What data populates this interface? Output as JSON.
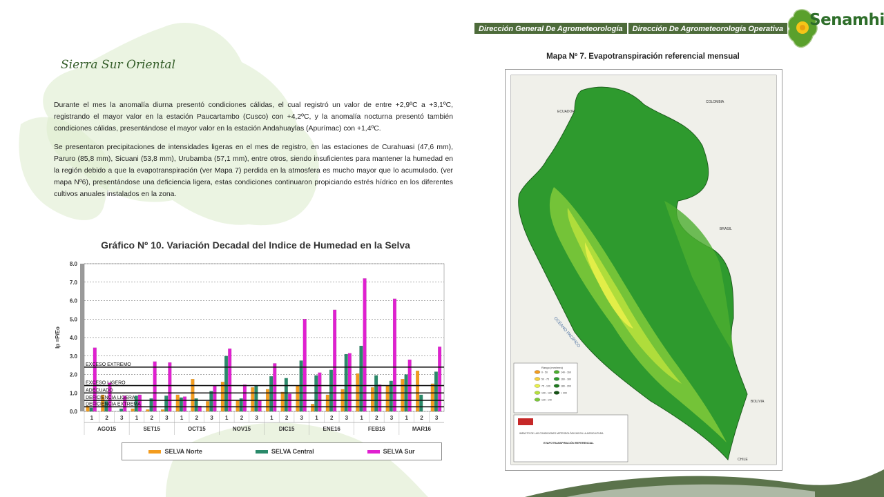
{
  "header": {
    "nav_left": "Dirección General De Agrometeorología",
    "nav_right": "Dirección De Agrometeorología Operativa",
    "logo_text": "Senamhi"
  },
  "section_title": "Sierra Sur Oriental",
  "paragraphs": [
    "Durante el mes la anomalía diurna presentó condiciones cálidas, el cual registró un valor de entre +2,9ºC a +3,1ºC, registrando el mayor valor en la estación Paucartambo (Cusco) con +4,2ºC, y la anomalía nocturna presentó también condiciones cálidas, presentándose el mayor valor en la estación Andahuaylas (Apurímac) con +1,4ºC.",
    "Se presentaron precipitaciones de intensidades ligeras en el mes de registro, en las estaciones de Curahuasi (47,6 mm), Paruro (85,8 mm), Sicuani (53,8 mm), Urubamba (57,1 mm), entre otros, siendo insuficientes para mantener la humedad en la región debido a que la evapotranspiración (ver Mapa 7) perdida en la atmosfera es mucho mayor que lo acumulado. (ver mapa Nº6), presentándose una deficiencia ligera, estas condiciones continuaron propiciando estrés hídrico en los diferentes cultivos anuales instalados en la zona."
  ],
  "map": {
    "title": "Mapa Nº 7. Evapotranspiración referencial mensual",
    "labels": {
      "ecuador": "ECUADOR",
      "colombia": "COLOMBIA",
      "brasil": "BRASIL",
      "bolivia": "BOLIVIA",
      "chile": "CHILE",
      "ocean": "OCÉANO PACÍFICO"
    },
    "legend_title": "Rango (mm/mes)",
    "legend_ranges": [
      "0 - 50",
      "50 - 75",
      "75 - 100",
      "100 - 120",
      "120 - 140",
      "140 - 160",
      "160 - 180",
      "180 - 200",
      "> 200"
    ],
    "box_title": "IMPACTO DE LAS CONDICIONES METEOROLÓGICAS EN LA AGRICULTURA",
    "box_subtitle": "EVAPOTRANSPIRACIÓN REFERENCIAL",
    "colors": [
      "#2e9a2e",
      "#4cae30",
      "#7cc83a",
      "#b6e03c",
      "#e8f04a"
    ]
  },
  "chart_data": {
    "type": "bar",
    "title": "Gráfico Nº 10. Variación Decadal del Indice de Humedad en la Selva",
    "ylabel": "Ip =P/Eo",
    "ylim": [
      0,
      8
    ],
    "yticks": [
      "0.0",
      "1.0",
      "2.0",
      "3.0",
      "4.0",
      "5.0",
      "6.0",
      "7.0",
      "8.0"
    ],
    "months": [
      "AGO15",
      "SET15",
      "OCT15",
      "NOV15",
      "DIC15",
      "ENE16",
      "FEB16",
      "MAR16"
    ],
    "decades": [
      "1",
      "2",
      "3"
    ],
    "thresholds": [
      {
        "label": "EXCESO EXTREMO",
        "value": 2.4
      },
      {
        "label": "EXCESO LIGERO",
        "value": 1.4
      },
      {
        "label": "ADECUADO",
        "value": 1.0
      },
      {
        "label": "DEFICIENCIA LIGERA",
        "value": 0.6
      },
      {
        "label": "DEFICIENCIA EXTREMA",
        "value": 0.25
      }
    ],
    "series": [
      {
        "name": "SELVA Norte",
        "color": "#f39c1e",
        "values": [
          0.3,
          0.9,
          0.0,
          0.15,
          0.1,
          0.1,
          0.9,
          1.75,
          0.55,
          1.6,
          0.6,
          1.3,
          1.2,
          1.05,
          1.4,
          0.4,
          0.9,
          1.2,
          2.05,
          1.3,
          1.4,
          1.75,
          2.2,
          1.5
        ]
      },
      {
        "name": "SELVA Central",
        "color": "#2a8a6a",
        "values": [
          0.2,
          0.55,
          0.15,
          0.85,
          0.7,
          0.85,
          0.75,
          0.7,
          1.1,
          3.0,
          0.7,
          1.4,
          1.9,
          1.8,
          2.75,
          1.95,
          2.25,
          3.1,
          3.55,
          1.95,
          1.65,
          2.0,
          0.9,
          2.15
        ]
      },
      {
        "name": "SELVA Sur",
        "color": "#e020d0",
        "values": [
          3.45,
          1.55,
          0.85,
          0.9,
          2.7,
          2.65,
          0.8,
          0.3,
          1.4,
          3.4,
          1.45,
          0.6,
          2.6,
          0.95,
          5.0,
          2.1,
          5.5,
          3.15,
          7.2,
          1.45,
          6.1,
          2.8,
          0.0,
          3.5
        ]
      }
    ]
  }
}
